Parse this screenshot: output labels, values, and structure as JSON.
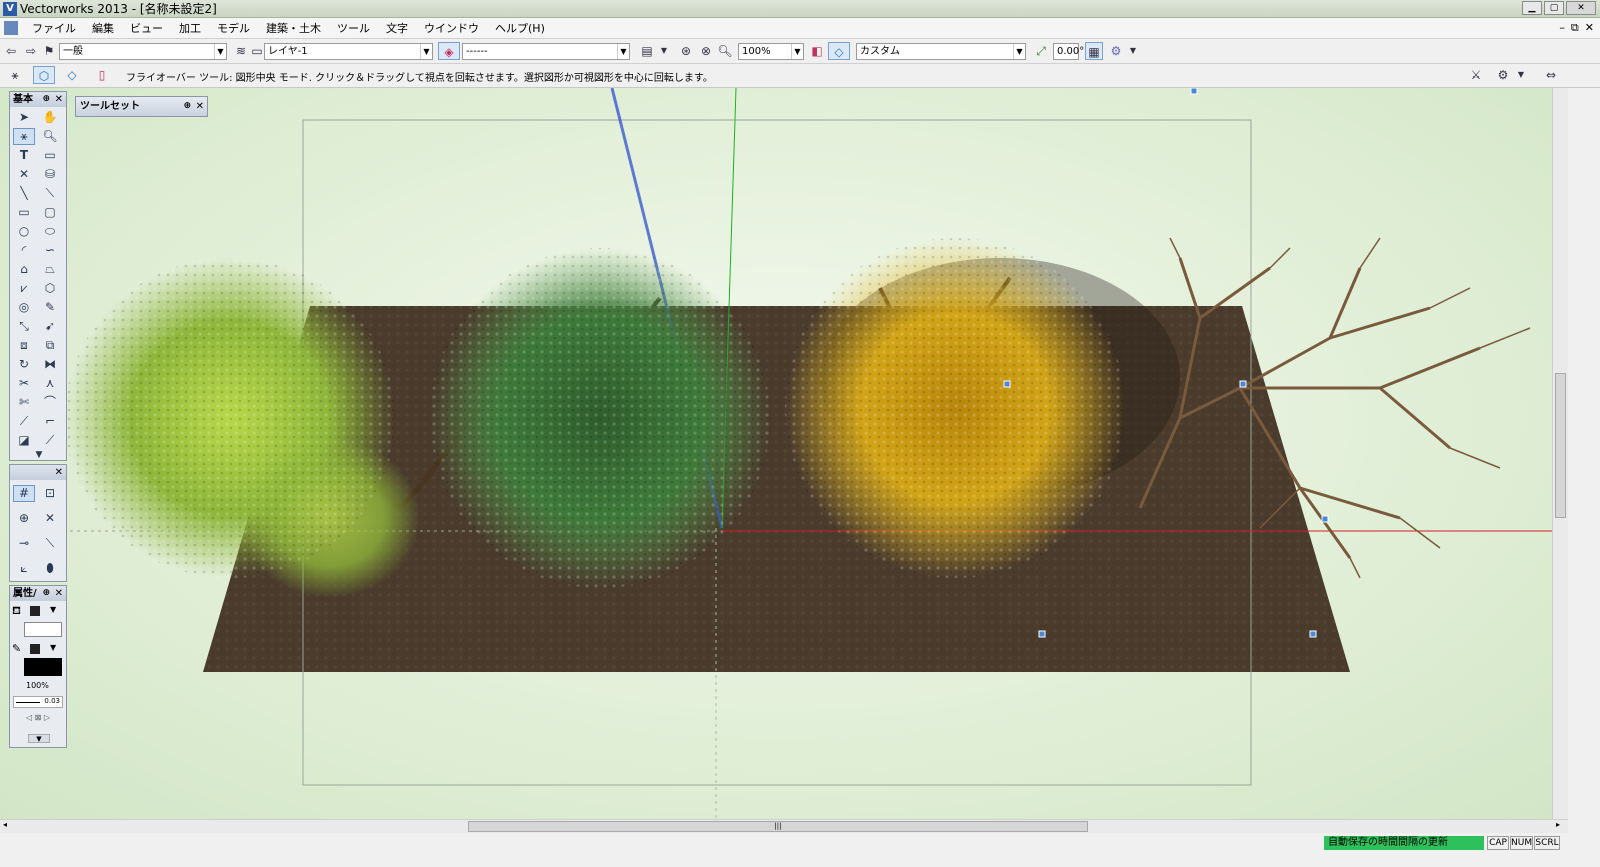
{
  "window": {
    "title": "Vectorworks 2013 - [名称未設定2]",
    "app_icon": "V",
    "buttons": [
      "minimize",
      "maximize",
      "close"
    ]
  },
  "menu": {
    "items": [
      "ファイル",
      "編集",
      "ビュー",
      "加工",
      "モデル",
      "建築・土木",
      "ツール",
      "文字",
      "ウインドウ",
      "ヘルプ(H)"
    ],
    "mdi": [
      "–",
      "⧉",
      "✕"
    ]
  },
  "viewbar": {
    "class_value": "一般",
    "layer_value": "レイヤ-1",
    "saved_view_value": "------",
    "zoom_value": "100%",
    "view_value": "カスタム",
    "angle_value": "0.00°"
  },
  "modebar": {
    "hint": "フライオーバー ツール: 図形中央 モード. クリック＆ドラッグして視点を回転させます。選択図形か可視図形を中心に回転します。"
  },
  "palettes": {
    "basic": {
      "title": "基本"
    },
    "toolsets": {
      "title": "ツールセット"
    },
    "snap": {
      "title": ""
    },
    "attributes": {
      "title": "属性/",
      "opacity": "100%",
      "line_weight": "0.03"
    }
  },
  "status": {
    "message": "自動保存の時間間隔の更新",
    "indicators": [
      "CAP",
      "NUM",
      "SCRL"
    ]
  },
  "colors": {
    "ground": "#4a3b2c",
    "canvas": "#e4f0da",
    "status_green": "#2ec05a",
    "x_axis": "#d02020",
    "y_axis": "#20b020",
    "z_axis": "#3050d0"
  },
  "scene": {
    "trees": [
      {
        "name": "light-green-tree",
        "color": "#8fb63a"
      },
      {
        "name": "dark-green-tree",
        "color": "#3f7a3a"
      },
      {
        "name": "yellow-autumn-tree",
        "color": "#d2a417"
      },
      {
        "name": "bare-tree",
        "color": "#7a5a3c"
      }
    ]
  }
}
